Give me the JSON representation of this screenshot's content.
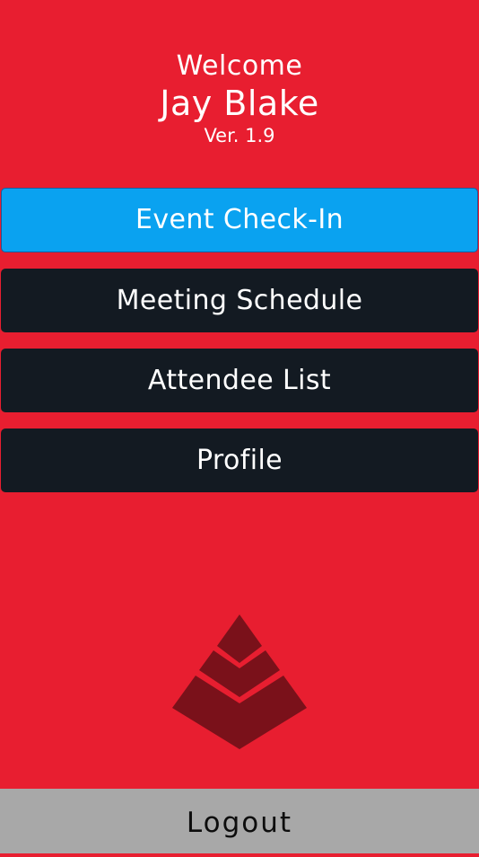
{
  "header": {
    "welcome": "Welcome",
    "user_name": "Jay Blake",
    "version": "Ver. 1.9"
  },
  "menu": {
    "items": [
      {
        "label": "Event Check-In",
        "active": true
      },
      {
        "label": "Meeting Schedule",
        "active": false
      },
      {
        "label": "Attendee List",
        "active": false
      },
      {
        "label": "Profile",
        "active": false
      }
    ]
  },
  "logo": {
    "icon": "pyramid-logo-icon"
  },
  "footer": {
    "logout_label": "Logout"
  },
  "colors": {
    "background": "#e81e30",
    "active_button": "#0aa2f0",
    "dark_button": "#131a22",
    "logout_bar": "#a8a8a8",
    "logo": "#7a111a"
  }
}
